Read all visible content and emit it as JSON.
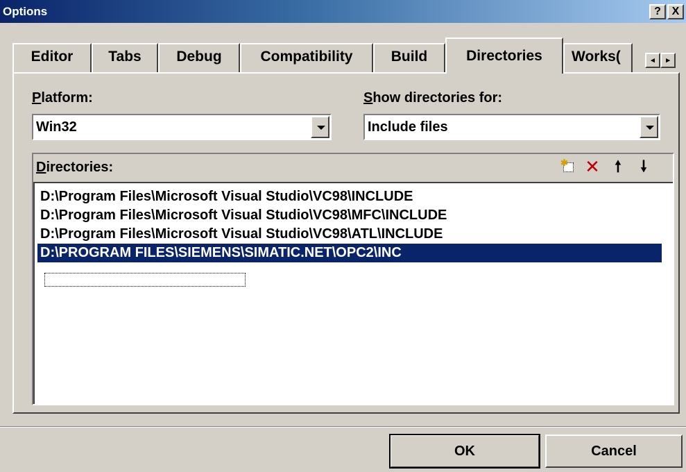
{
  "window": {
    "title": "Options",
    "help_label": "?",
    "close_label": "X"
  },
  "tabs": [
    {
      "label": "Editor"
    },
    {
      "label": "Tabs"
    },
    {
      "label": "Debug"
    },
    {
      "label": "Compatibility"
    },
    {
      "label": "Build"
    },
    {
      "label": "Directories"
    },
    {
      "label": "Works("
    }
  ],
  "active_tab": "Directories",
  "tab_scroll": {
    "left": "◂",
    "right": "▸"
  },
  "platform": {
    "label_accel": "P",
    "label_rest": "latform:",
    "value": "Win32"
  },
  "show_dirs": {
    "label_accel": "S",
    "label_rest": "how directories for:",
    "value": "Include files"
  },
  "directories": {
    "label_accel": "D",
    "label_rest": "irectories:",
    "icons": [
      "new-folder-icon",
      "delete-icon",
      "move-up-icon",
      "move-down-icon"
    ],
    "items": [
      "D:\\Program Files\\Microsoft Visual Studio\\VC98\\INCLUDE",
      "D:\\Program Files\\Microsoft Visual Studio\\VC98\\MFC\\INCLUDE",
      "D:\\Program Files\\Microsoft Visual Studio\\VC98\\ATL\\INCLUDE",
      "D:\\PROGRAM FILES\\SIEMENS\\SIMATIC.NET\\OPC2\\INC"
    ],
    "selected_index": 3,
    "selection_color": "#0a246a"
  },
  "buttons": {
    "ok": "OK",
    "cancel": "Cancel"
  }
}
